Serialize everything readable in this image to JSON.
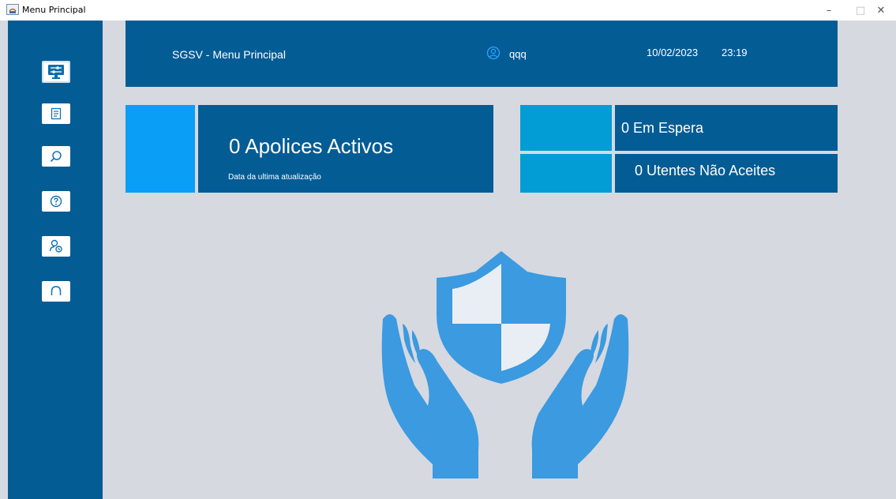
{
  "window": {
    "title": "Menu Principal",
    "controls": [
      "–",
      "□",
      "✕"
    ]
  },
  "sidebar": {
    "items": [
      {
        "icon": "dashboard-icon",
        "active": true
      },
      {
        "icon": "document-icon"
      },
      {
        "icon": "search-icon"
      },
      {
        "icon": "help-icon"
      },
      {
        "icon": "user-settings-icon"
      },
      {
        "icon": "headset-icon"
      }
    ]
  },
  "header": {
    "app_title": "SGSV - Menu Principal",
    "user_name": "qqq",
    "date": "10/02/2023",
    "time": "23:19"
  },
  "cards": {
    "policies": {
      "title": "0 Apolices Activos",
      "subtitle": "Data da ultima atualização"
    },
    "waiting": {
      "title": "0 Em Espera"
    },
    "rejected": {
      "title": "0 Utentes Não Aceites"
    }
  },
  "colors": {
    "sidebar": "#045c95",
    "accent_blue": "#0a9ef7",
    "accent_cyan": "#039dd6",
    "background": "#d6d9e0",
    "hero": "#3b9ae0"
  },
  "hero": {
    "icon": "shield-hands-icon"
  }
}
